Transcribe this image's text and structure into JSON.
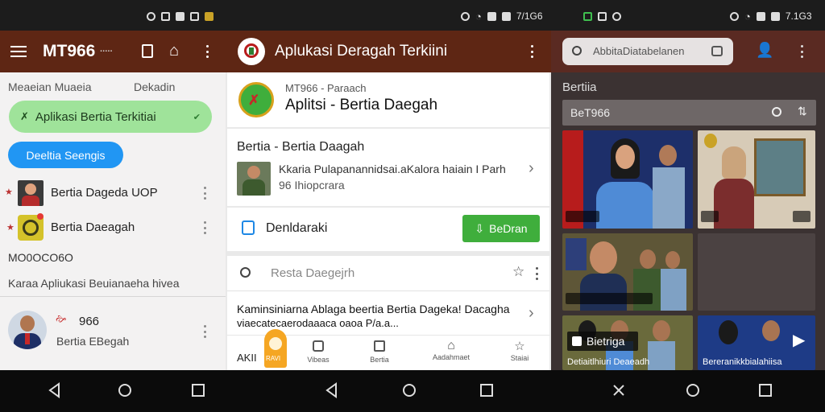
{
  "statusbar": {
    "time": "7/1G6",
    "time_right": "7.1G3"
  },
  "panel1": {
    "title": "MT966",
    "title_suffix": "▪▪▪▪▪",
    "tab_left": "Meaeian Muaeia",
    "tab_right": "Dekadin",
    "chip_green": "Aplikasi Bertia Terkitiai",
    "chip_blue": "Deeltia Seengis",
    "items": [
      {
        "label": "Bertia Dageda UOP"
      },
      {
        "label": "Bertia Daeagah"
      }
    ],
    "section_code": "MO0OCO6O",
    "section_desc": "Karaa Apliukasi Beuianaeha hivea",
    "profile_name": "966",
    "profile_sub": "Bertia EBegah"
  },
  "panel2": {
    "app_title": "Aplukasi Deragah Terkiini",
    "header_card": {
      "kicker": "MT966 - Paraach",
      "title": "Aplitsi - Bertia Daegah"
    },
    "news_card": {
      "heading": "Bertia - Bertia Daagah",
      "line1": "Kkaria Pulapanannidsai.aKalora haiain I Parh",
      "line2": "96 Ihiopcrara"
    },
    "download": {
      "label": "Denldaraki",
      "button": "BeDran"
    },
    "search": {
      "placeholder": "Resta Daegejrh"
    },
    "article": {
      "line1": "Kaminsiniarna Ablaga beertia Bertia Dageka! Dacagha",
      "line2": "viaecatecaerodaaaca oaoa P/a.a..."
    },
    "bottom_nav": [
      {
        "label": "Vibeas",
        "icon": "video-icon"
      },
      {
        "label": "Bertia",
        "icon": "news-icon"
      },
      {
        "label": "Aadahmaet",
        "icon": "home-icon"
      },
      {
        "label": "Staiai",
        "icon": "star-icon"
      }
    ],
    "bottom_left": "AKII",
    "fab_label": "RAVI"
  },
  "panel3": {
    "search_placeholder": "AbbitaDiatabelanen",
    "section_title": "Bertiia",
    "filter_value": "BeT966",
    "badge_label": "Bietriga",
    "caption_left": "Detiaitlhiuri Deaeadh",
    "caption_right": "Bereranikkbialahiisa"
  },
  "colors": {
    "appbar": "#5e2614",
    "green": "#3fae3c",
    "blue": "#2196f3",
    "chip_green_bg": "#9fe39a"
  }
}
